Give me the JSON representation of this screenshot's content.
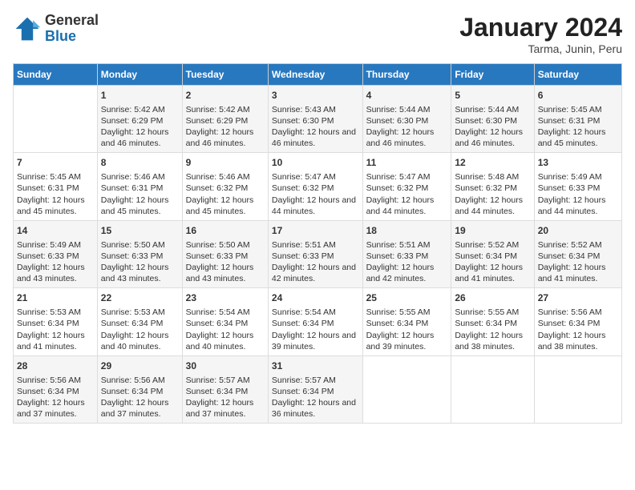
{
  "logo": {
    "general": "General",
    "blue": "Blue"
  },
  "title": "January 2024",
  "subtitle": "Tarma, Junin, Peru",
  "headers": [
    "Sunday",
    "Monday",
    "Tuesday",
    "Wednesday",
    "Thursday",
    "Friday",
    "Saturday"
  ],
  "rows": [
    [
      {
        "day": "",
        "sunrise": "",
        "sunset": "",
        "daylight": ""
      },
      {
        "day": "1",
        "sunrise": "Sunrise: 5:42 AM",
        "sunset": "Sunset: 6:29 PM",
        "daylight": "Daylight: 12 hours and 46 minutes."
      },
      {
        "day": "2",
        "sunrise": "Sunrise: 5:42 AM",
        "sunset": "Sunset: 6:29 PM",
        "daylight": "Daylight: 12 hours and 46 minutes."
      },
      {
        "day": "3",
        "sunrise": "Sunrise: 5:43 AM",
        "sunset": "Sunset: 6:30 PM",
        "daylight": "Daylight: 12 hours and 46 minutes."
      },
      {
        "day": "4",
        "sunrise": "Sunrise: 5:44 AM",
        "sunset": "Sunset: 6:30 PM",
        "daylight": "Daylight: 12 hours and 46 minutes."
      },
      {
        "day": "5",
        "sunrise": "Sunrise: 5:44 AM",
        "sunset": "Sunset: 6:30 PM",
        "daylight": "Daylight: 12 hours and 46 minutes."
      },
      {
        "day": "6",
        "sunrise": "Sunrise: 5:45 AM",
        "sunset": "Sunset: 6:31 PM",
        "daylight": "Daylight: 12 hours and 45 minutes."
      }
    ],
    [
      {
        "day": "7",
        "sunrise": "Sunrise: 5:45 AM",
        "sunset": "Sunset: 6:31 PM",
        "daylight": "Daylight: 12 hours and 45 minutes."
      },
      {
        "day": "8",
        "sunrise": "Sunrise: 5:46 AM",
        "sunset": "Sunset: 6:31 PM",
        "daylight": "Daylight: 12 hours and 45 minutes."
      },
      {
        "day": "9",
        "sunrise": "Sunrise: 5:46 AM",
        "sunset": "Sunset: 6:32 PM",
        "daylight": "Daylight: 12 hours and 45 minutes."
      },
      {
        "day": "10",
        "sunrise": "Sunrise: 5:47 AM",
        "sunset": "Sunset: 6:32 PM",
        "daylight": "Daylight: 12 hours and 44 minutes."
      },
      {
        "day": "11",
        "sunrise": "Sunrise: 5:47 AM",
        "sunset": "Sunset: 6:32 PM",
        "daylight": "Daylight: 12 hours and 44 minutes."
      },
      {
        "day": "12",
        "sunrise": "Sunrise: 5:48 AM",
        "sunset": "Sunset: 6:32 PM",
        "daylight": "Daylight: 12 hours and 44 minutes."
      },
      {
        "day": "13",
        "sunrise": "Sunrise: 5:49 AM",
        "sunset": "Sunset: 6:33 PM",
        "daylight": "Daylight: 12 hours and 44 minutes."
      }
    ],
    [
      {
        "day": "14",
        "sunrise": "Sunrise: 5:49 AM",
        "sunset": "Sunset: 6:33 PM",
        "daylight": "Daylight: 12 hours and 43 minutes."
      },
      {
        "day": "15",
        "sunrise": "Sunrise: 5:50 AM",
        "sunset": "Sunset: 6:33 PM",
        "daylight": "Daylight: 12 hours and 43 minutes."
      },
      {
        "day": "16",
        "sunrise": "Sunrise: 5:50 AM",
        "sunset": "Sunset: 6:33 PM",
        "daylight": "Daylight: 12 hours and 43 minutes."
      },
      {
        "day": "17",
        "sunrise": "Sunrise: 5:51 AM",
        "sunset": "Sunset: 6:33 PM",
        "daylight": "Daylight: 12 hours and 42 minutes."
      },
      {
        "day": "18",
        "sunrise": "Sunrise: 5:51 AM",
        "sunset": "Sunset: 6:33 PM",
        "daylight": "Daylight: 12 hours and 42 minutes."
      },
      {
        "day": "19",
        "sunrise": "Sunrise: 5:52 AM",
        "sunset": "Sunset: 6:34 PM",
        "daylight": "Daylight: 12 hours and 41 minutes."
      },
      {
        "day": "20",
        "sunrise": "Sunrise: 5:52 AM",
        "sunset": "Sunset: 6:34 PM",
        "daylight": "Daylight: 12 hours and 41 minutes."
      }
    ],
    [
      {
        "day": "21",
        "sunrise": "Sunrise: 5:53 AM",
        "sunset": "Sunset: 6:34 PM",
        "daylight": "Daylight: 12 hours and 41 minutes."
      },
      {
        "day": "22",
        "sunrise": "Sunrise: 5:53 AM",
        "sunset": "Sunset: 6:34 PM",
        "daylight": "Daylight: 12 hours and 40 minutes."
      },
      {
        "day": "23",
        "sunrise": "Sunrise: 5:54 AM",
        "sunset": "Sunset: 6:34 PM",
        "daylight": "Daylight: 12 hours and 40 minutes."
      },
      {
        "day": "24",
        "sunrise": "Sunrise: 5:54 AM",
        "sunset": "Sunset: 6:34 PM",
        "daylight": "Daylight: 12 hours and 39 minutes."
      },
      {
        "day": "25",
        "sunrise": "Sunrise: 5:55 AM",
        "sunset": "Sunset: 6:34 PM",
        "daylight": "Daylight: 12 hours and 39 minutes."
      },
      {
        "day": "26",
        "sunrise": "Sunrise: 5:55 AM",
        "sunset": "Sunset: 6:34 PM",
        "daylight": "Daylight: 12 hours and 38 minutes."
      },
      {
        "day": "27",
        "sunrise": "Sunrise: 5:56 AM",
        "sunset": "Sunset: 6:34 PM",
        "daylight": "Daylight: 12 hours and 38 minutes."
      }
    ],
    [
      {
        "day": "28",
        "sunrise": "Sunrise: 5:56 AM",
        "sunset": "Sunset: 6:34 PM",
        "daylight": "Daylight: 12 hours and 37 minutes."
      },
      {
        "day": "29",
        "sunrise": "Sunrise: 5:56 AM",
        "sunset": "Sunset: 6:34 PM",
        "daylight": "Daylight: 12 hours and 37 minutes."
      },
      {
        "day": "30",
        "sunrise": "Sunrise: 5:57 AM",
        "sunset": "Sunset: 6:34 PM",
        "daylight": "Daylight: 12 hours and 37 minutes."
      },
      {
        "day": "31",
        "sunrise": "Sunrise: 5:57 AM",
        "sunset": "Sunset: 6:34 PM",
        "daylight": "Daylight: 12 hours and 36 minutes."
      },
      {
        "day": "",
        "sunrise": "",
        "sunset": "",
        "daylight": ""
      },
      {
        "day": "",
        "sunrise": "",
        "sunset": "",
        "daylight": ""
      },
      {
        "day": "",
        "sunrise": "",
        "sunset": "",
        "daylight": ""
      }
    ]
  ]
}
